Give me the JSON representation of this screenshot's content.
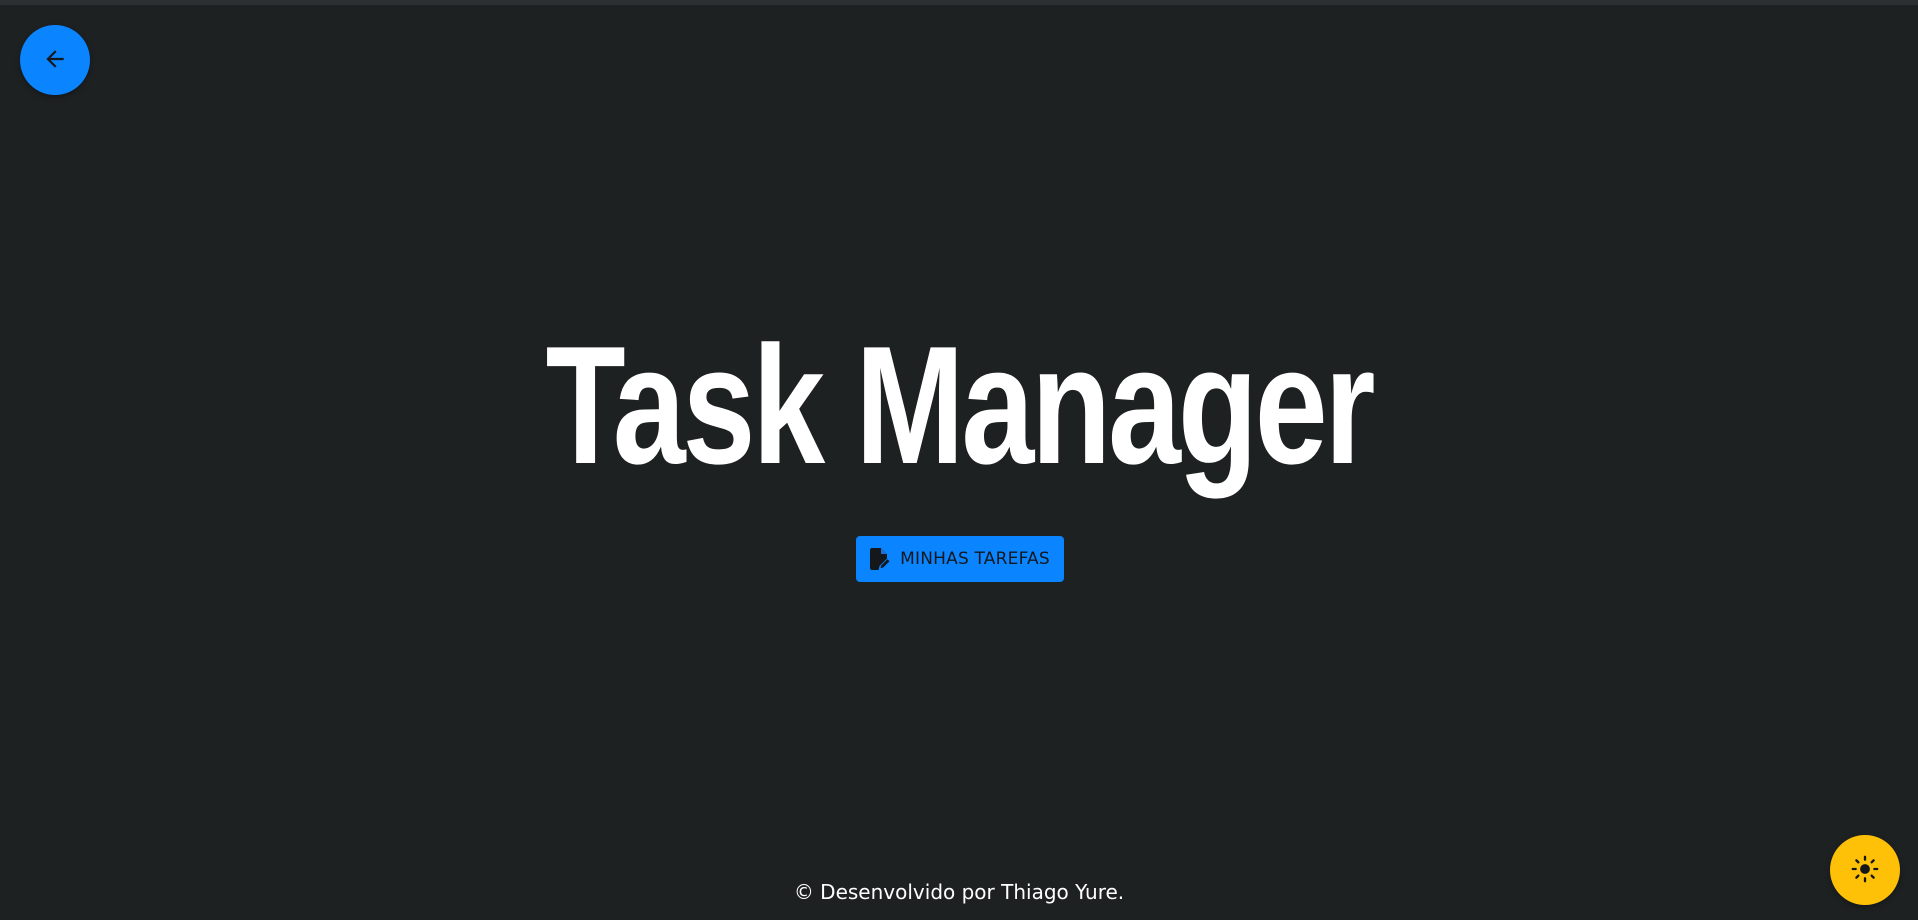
{
  "header": {
    "back_icon": "arrow-left-icon"
  },
  "hero": {
    "title": "Task Manager"
  },
  "actions": {
    "tasks_label": "MINHAS TAREFAS",
    "tasks_icon": "file-edit-icon"
  },
  "footer": {
    "text": "© Desenvolvido por Thiago Yure."
  },
  "theme_toggle": {
    "icon": "sun-icon"
  },
  "colors": {
    "background": "#1e2122",
    "accent": "#0a84ff",
    "theme_toggle": "#ffc107",
    "text": "#ffffff"
  }
}
